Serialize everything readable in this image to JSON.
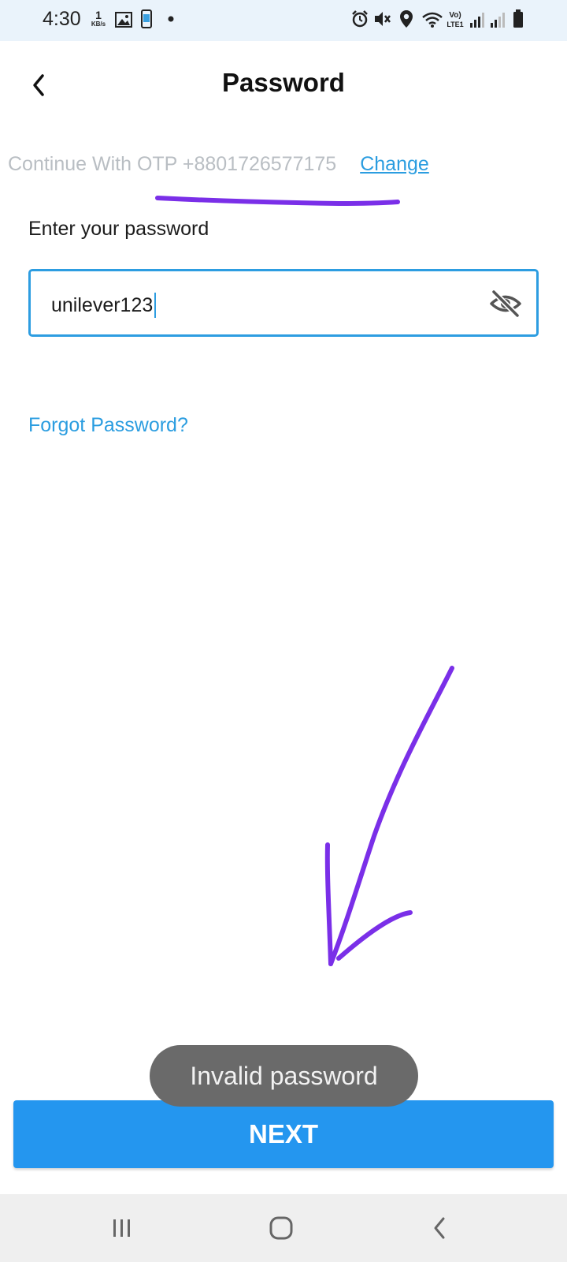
{
  "status_bar": {
    "time": "4:30",
    "net_speed_value": "1",
    "net_speed_unit": "KB/s",
    "icons": [
      "image-icon",
      "sim-icon",
      "dot-icon",
      "alarm-icon",
      "mute-icon",
      "location-icon",
      "wifi-icon",
      "volte-icon",
      "signal-icon",
      "signal-icon",
      "battery-icon"
    ]
  },
  "header": {
    "title": "Password",
    "back_icon": "chevron-left-icon"
  },
  "otp": {
    "text": "Continue With OTP +8801726577175",
    "change_label": "Change"
  },
  "password": {
    "label": "Enter your password",
    "value": "unilever123",
    "toggle_icon": "eye-off-icon"
  },
  "forgot_label": "Forgot Password?",
  "toast": "Invalid password",
  "next_label": "NEXT",
  "nav_bar": {
    "icons": [
      "recent-apps-icon",
      "home-icon",
      "back-icon"
    ]
  },
  "colors": {
    "accent": "#2496ef",
    "link": "#2b9de0",
    "annotation": "#7a2fe8",
    "toast_bg": "#6a6a6a",
    "status_bar_bg": "#eaf3fb",
    "nav_bar_bg": "#efefef"
  }
}
